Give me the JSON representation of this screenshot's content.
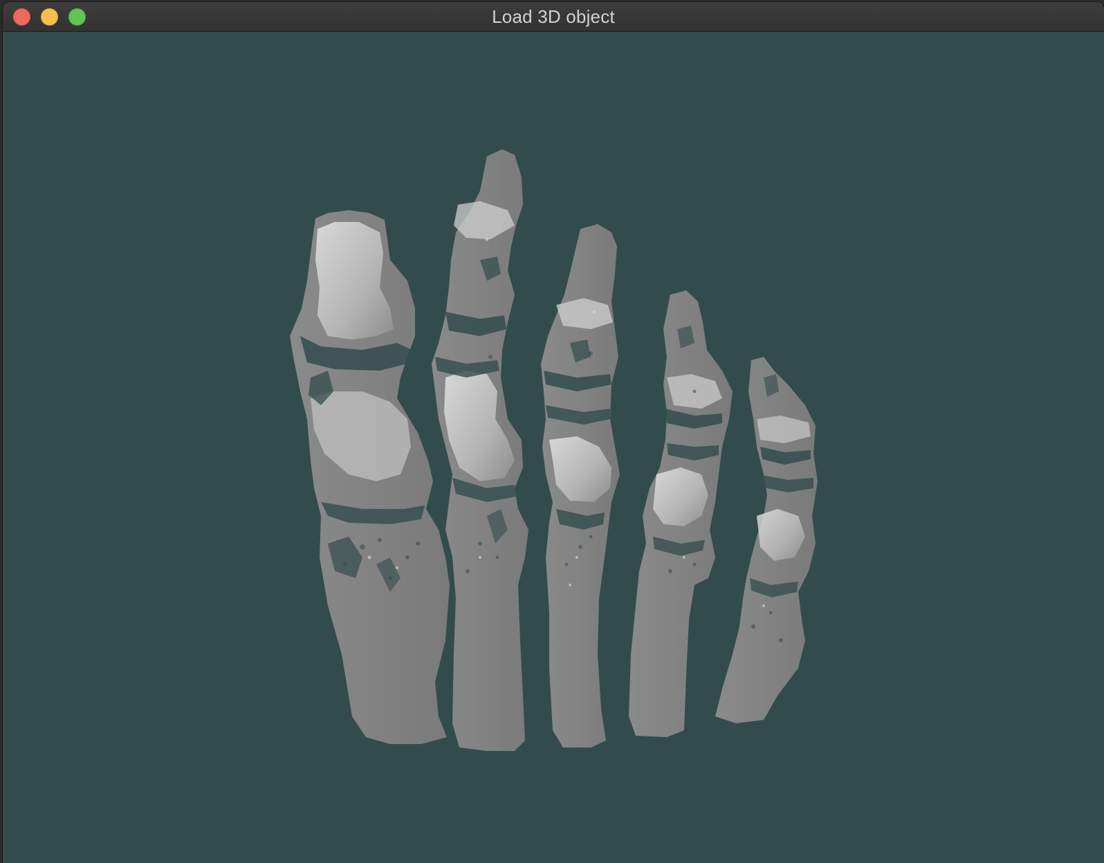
{
  "window": {
    "title": "Load 3D object"
  },
  "titlebar_buttons": [
    {
      "name": "close",
      "color": "#ed6a5e"
    },
    {
      "name": "minimize",
      "color": "#f5bf4f"
    },
    {
      "name": "maximize",
      "color": "#61c554"
    }
  ],
  "viewport": {
    "background_color": "#324c4c",
    "model_color": "#808080",
    "highlight_color": "#d8d8d8",
    "bones": [
      {
        "name": "first-ray"
      },
      {
        "name": "second-ray"
      },
      {
        "name": "third-ray"
      },
      {
        "name": "fourth-ray"
      },
      {
        "name": "fifth-ray"
      }
    ]
  }
}
